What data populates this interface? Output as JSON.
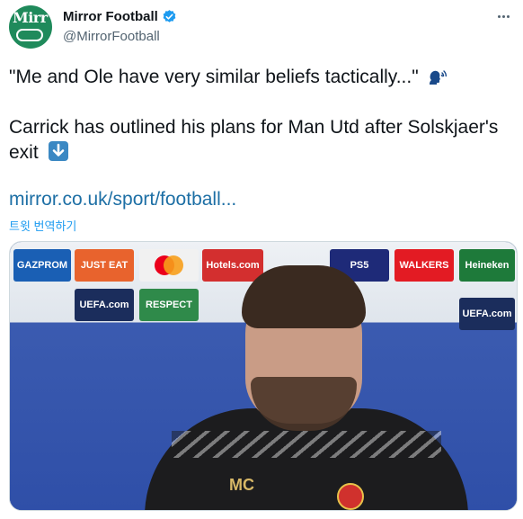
{
  "tweet": {
    "display_name": "Mirror Football",
    "handle": "@MirrorFootball",
    "avatar_text": "Mirr",
    "more_icon": "more-icon",
    "verified_icon": "verified-badge-icon",
    "quote": "\"Me and Ole have very similar beliefs tactically...\"",
    "speak_icon": "speaking-head-icon",
    "body_line": "Carrick has outlined his plans for Man Utd after Solskjaer's exit",
    "arrow_icon": "down-arrow-icon",
    "link": "mirror.co.uk/sport/football...",
    "translate": "트윗 번역하기"
  },
  "media": {
    "sponsors": [
      "GAZPROM",
      "JUST EAT",
      "Hotels.com",
      "PS5",
      "WALKERS",
      "Heineken",
      "UEFA.com",
      "RESPECT",
      "UEFA.com"
    ],
    "shirt_initials": "MC"
  },
  "colors": {
    "link": "#1d6fa5",
    "verified": "#1d9bf0",
    "avatar": "#1f8a5b"
  }
}
